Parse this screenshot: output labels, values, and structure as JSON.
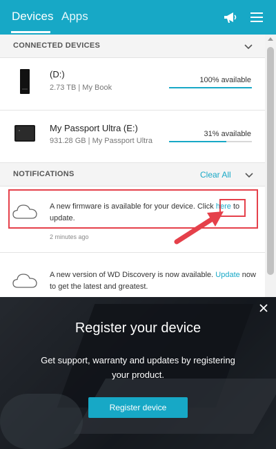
{
  "header": {
    "tabs": [
      {
        "label": "Devices"
      },
      {
        "label": "Apps"
      }
    ],
    "icons": [
      "megaphone-icon",
      "hamburger-menu-icon"
    ],
    "accent_color": "#17a8c6"
  },
  "connected": {
    "title": "CONNECTED DEVICES",
    "devices": [
      {
        "name": "(D:)",
        "meta": "2.73 TB | My Book",
        "available_label": "100% available",
        "available_fraction": 1.0,
        "icon": "external-drive-icon"
      },
      {
        "name": "My Passport Ultra (E:)",
        "meta": "931.28 GB | My Passport Ultra",
        "available_label": "31% available",
        "available_fraction": 0.69,
        "icon": "portable-drive-icon"
      }
    ]
  },
  "notifications": {
    "title": "NOTIFICATIONS",
    "clear_all": "Clear All",
    "items": [
      {
        "text_before": "A new firmware is available for your device. Click ",
        "link": "here",
        "text_after": " to update.",
        "time": "2 minutes ago",
        "icon": "cloud-icon"
      },
      {
        "text_before": "A new version of WD Discovery is now available. ",
        "link": "Update",
        "text_after": " now to get the latest and greatest.",
        "icon": "cloud-icon"
      }
    ]
  },
  "register": {
    "title": "Register your device",
    "subtitle": "Get support, warranty and updates by registering your product.",
    "button": "Register device"
  },
  "annotation_color": "#e5404a"
}
